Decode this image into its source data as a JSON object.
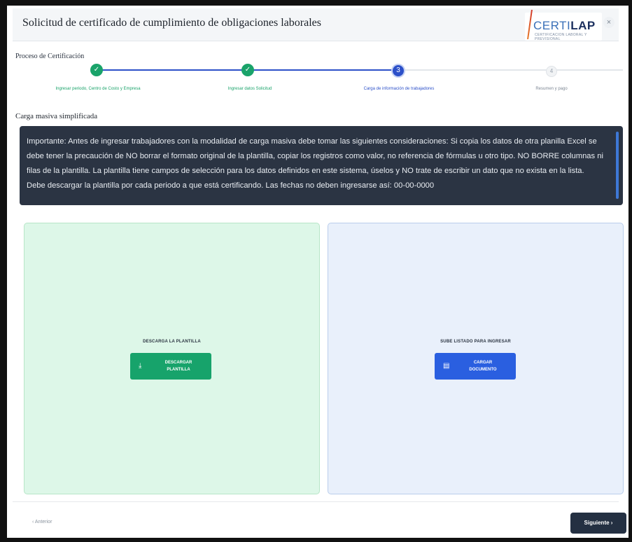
{
  "dialog": {
    "title": "Solicitud de certificado de cumplimiento de obligaciones laborales",
    "close_symbol": "×"
  },
  "logo": {
    "word_light": "CERTI",
    "word_bold": "LAP",
    "tagline": "CERTIFICACION LABORAL Y PREVISIONAL"
  },
  "process": {
    "label": "Proceso de Certificación",
    "steps": [
      {
        "label": "Ingresar periodo, Centro de Costo y Empresa",
        "status": "done",
        "marker": "✓"
      },
      {
        "label": "Ingresar datos Solicitud",
        "status": "done",
        "marker": "✓"
      },
      {
        "label": "Carga de información de trabajadores",
        "status": "active",
        "marker": "3"
      },
      {
        "label": "Resumen y pago",
        "status": "pending",
        "marker": "4"
      }
    ],
    "colors": {
      "done": "#1aa36a",
      "active": "#2c50c9",
      "pending": "#f1f3f5"
    }
  },
  "section": {
    "title": "Carga masiva simplificada"
  },
  "notice": {
    "text": "Importante: Antes de ingresar trabajadores con la modalidad de carga masiva debe tomar las siguientes consideraciones: Si copia los datos de otra planilla Excel se debe tener la precaución de NO borrar el formato original de la plantilla, copiar los registros como valor, no referencia de fórmulas u otro tipo. NO BORRE columnas ni filas de la plantilla. La plantilla tiene campos de selección para los datos definidos en este sistema, úselos y NO trate de escribir un dato que no exista en la lista. Debe descargar la plantilla por cada periodo a que está certificando. Las fechas no deben ingresarse así: 00-00-0000"
  },
  "download_panel": {
    "caption": "DESCARGA LA PLANTILLA",
    "button_label": "DESCARGAR\nPLANTILLA",
    "icon": "download-icon",
    "color": "#17a36b"
  },
  "upload_panel": {
    "caption": "SUBE LISTADO PARA INGRESAR",
    "button_label": "CARGAR\nDOCUMENTO",
    "icon": "document-icon",
    "color": "#2a5fe0"
  },
  "footer": {
    "back_label": "‹  Anterior",
    "next_label": "Siguiente  ›"
  }
}
